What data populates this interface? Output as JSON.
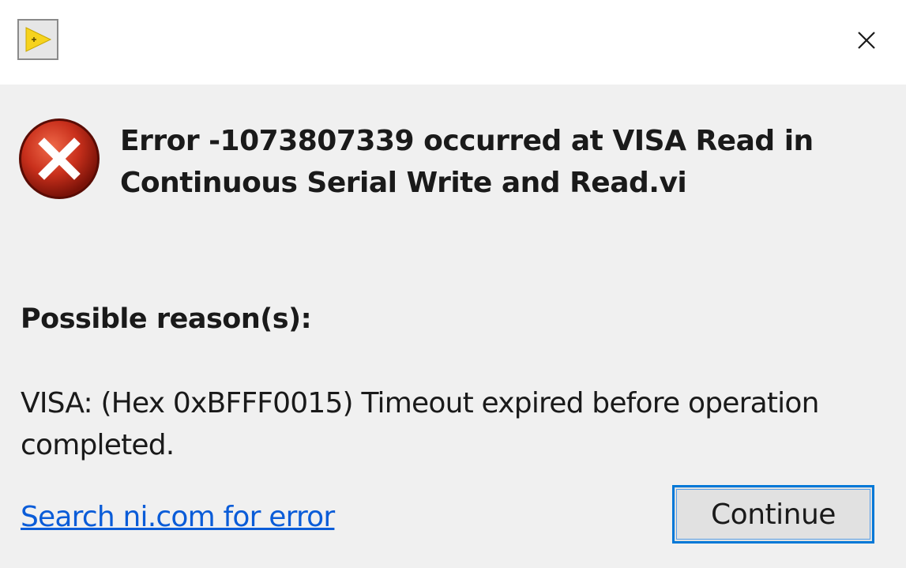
{
  "titlebar": {
    "app_icon": "labview-run-arrow-icon",
    "close_icon": "close-icon"
  },
  "dialog": {
    "error_icon": "error-x-icon",
    "title": "Error -1073807339 occurred at VISA Read in Continuous Serial Write and Read.vi",
    "reasons_heading": "Possible reason(s):",
    "reason_text": "VISA:  (Hex 0xBFFF0015) Timeout expired before operation completed.",
    "search_link": "Search ni.com for error",
    "continue_label": "Continue"
  },
  "colors": {
    "background": "#f0f0f0",
    "titlebar": "#ffffff",
    "link": "#0a5cd8",
    "focus_border": "#0078d7",
    "error_red": "#c0281a",
    "icon_yellow": "#f6d31e"
  }
}
